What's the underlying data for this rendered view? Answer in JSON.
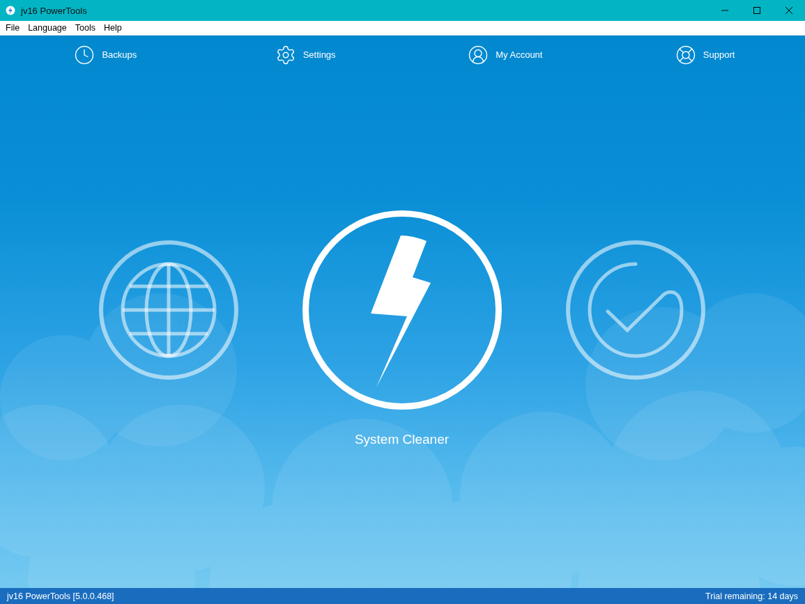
{
  "window": {
    "title": "jv16 PowerTools"
  },
  "menu": [
    "File",
    "Language",
    "Tools",
    "Help"
  ],
  "nav": [
    {
      "kind": "backups",
      "label": "Backups"
    },
    {
      "kind": "settings",
      "label": "Settings"
    },
    {
      "kind": "account",
      "label": "My Account"
    },
    {
      "kind": "support",
      "label": "Support"
    }
  ],
  "tools": [
    {
      "kind": "web",
      "selected": false
    },
    {
      "kind": "cleaner",
      "selected": true,
      "label": "System Cleaner"
    },
    {
      "kind": "check",
      "selected": false
    }
  ],
  "status_bar": {
    "version": "jv16 PowerTools [5.0.0.468]",
    "trial": "Trial remaining: 14 days"
  }
}
